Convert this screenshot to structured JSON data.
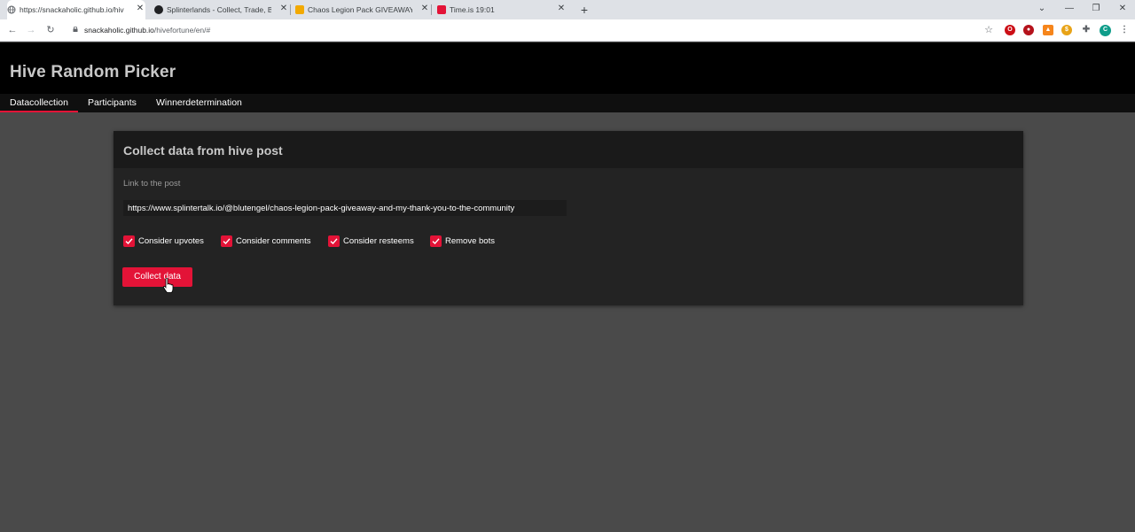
{
  "browser": {
    "tabs": [
      {
        "title": "https://snackaholic.github.io/hive",
        "favicon": "globe-icon",
        "color": "#5f6368"
      },
      {
        "title": "Splinterlands - Collect, Trade, Bat",
        "favicon": "splinterlands-icon",
        "color": "#202124"
      },
      {
        "title": "Chaos Legion Pack GIVEAWAY, a",
        "favicon": "splintertalk-icon",
        "color": "#f2a900"
      },
      {
        "title": "Time.is 19:01",
        "favicon": "timeis-icon",
        "color": "#e31337"
      }
    ],
    "new_tab": "+",
    "url_host": "snackaholic.github.io",
    "url_path": "/hivefortune/en/#"
  },
  "app": {
    "title": "Hive Random Picker",
    "tabs": [
      "Datacollection",
      "Participants",
      "Winnerdetermination"
    ],
    "active_tab": 0
  },
  "card": {
    "title": "Collect data from hive post",
    "link_label": "Link to the post",
    "link_value": "https://www.splintertalk.io/@blutengel/chaos-legion-pack-giveaway-and-my-thank-you-to-the-community",
    "checkboxes": [
      {
        "label": "Consider upvotes",
        "checked": true
      },
      {
        "label": "Consider comments",
        "checked": true
      },
      {
        "label": "Consider resteems",
        "checked": true
      },
      {
        "label": "Remove bots",
        "checked": true
      }
    ],
    "button_label": "Collect data"
  },
  "colors": {
    "accent": "#e31337",
    "header_bg": "#000000",
    "page_bg": "#4a4a4a",
    "card_bg": "#232323"
  }
}
